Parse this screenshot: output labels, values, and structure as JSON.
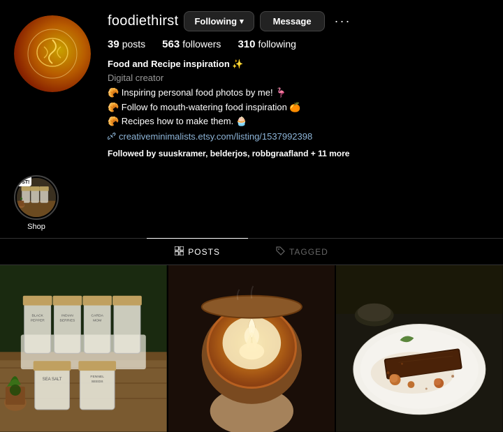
{
  "profile": {
    "username": "foodiethirst",
    "stats": {
      "posts_count": "39",
      "posts_label": "posts",
      "followers_count": "563",
      "followers_label": "followers",
      "following_count": "310",
      "following_label": "following"
    },
    "bio": {
      "name": "Food and Recipe inspiration ✨",
      "role": "Digital creator",
      "line1": "🥐 Inspiring personal food photos by me! 🦩",
      "line2": "🥐 Follow fo mouth-watering food inspiration 🍊",
      "line3": "🥐 Recipes how to make them. 🧁",
      "link": "creativeminimalists.etsy.com/listing/1537992398",
      "followed_by_text": "Followed by",
      "followed_by_names": "suuskramer, belderjos, robbgraafland",
      "followed_by_more": "+ 11 more"
    },
    "buttons": {
      "following": "Following",
      "message": "Message"
    }
  },
  "highlights": [
    {
      "label": "Shop",
      "new_post": "NEW POST!"
    }
  ],
  "tabs": [
    {
      "label": "POSTS",
      "active": true,
      "icon": "grid"
    },
    {
      "label": "TAGGED",
      "active": false,
      "icon": "tag"
    }
  ],
  "grid": {
    "items": [
      {
        "alt": "Spice jars on wooden board"
      },
      {
        "alt": "Latte art coffee"
      },
      {
        "alt": "Chocolate dessert on plate"
      }
    ]
  }
}
